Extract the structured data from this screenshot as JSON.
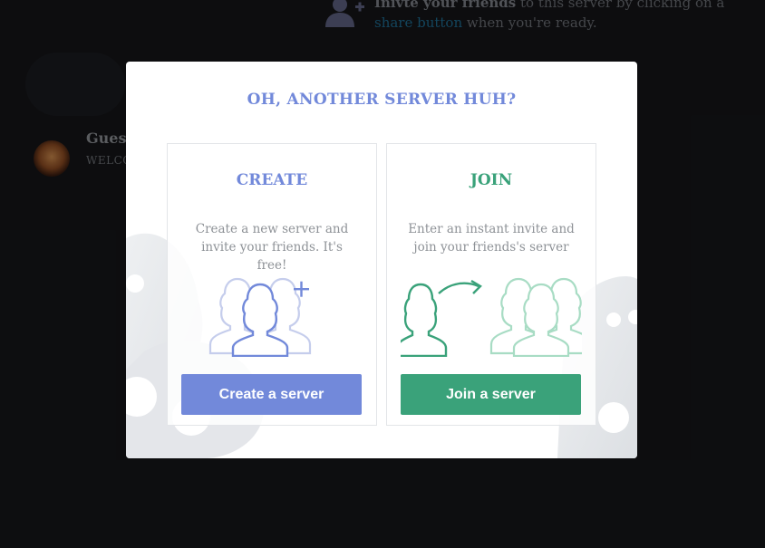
{
  "colors": {
    "accent_blue": "#7289da",
    "accent_green": "#3aa27a"
  },
  "background": {
    "invite_hint": {
      "bold": "Inivte your friends",
      "middle": "to this server by clicking on a",
      "link": "share button",
      "end": "when you're ready.",
      "icon": "add-user-icon"
    },
    "guest": {
      "name": "Guest",
      "subtitle": "WELCO"
    }
  },
  "modal": {
    "title": "OH, ANOTHER SERVER HUH?",
    "create": {
      "title": "CREATE",
      "description": "Create a new server and invite your friends. It's free!",
      "button": "Create a server",
      "icon": "create-server-illustration"
    },
    "join": {
      "title": "JOIN",
      "description": "Enter an instant invite and join your friends's server",
      "button": "Join a server",
      "icon": "join-server-illustration"
    }
  }
}
